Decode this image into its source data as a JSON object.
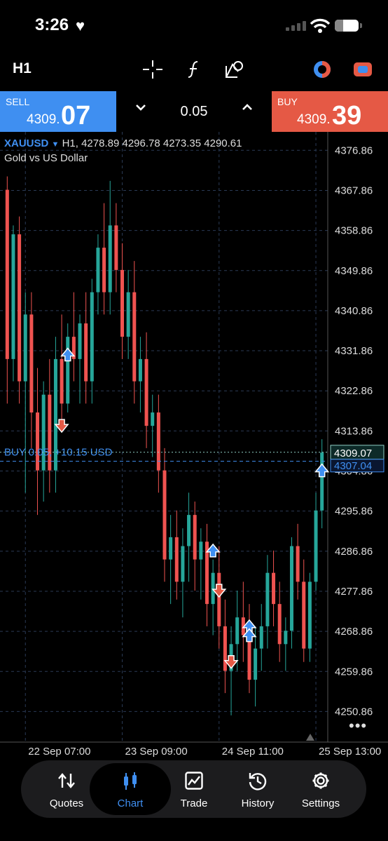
{
  "status": {
    "time": "3:26"
  },
  "toolbar": {
    "timeframe": "H1"
  },
  "trade": {
    "sell_label": "SELL",
    "sell_price_small": "4309.",
    "sell_price_big": "07",
    "lot": "0.05",
    "buy_label": "BUY",
    "buy_price_small": "4309.",
    "buy_price_big": "39"
  },
  "chart": {
    "symbol": "XAUUSD",
    "ohlc": "H1, 4278.89 4296.78 4273.35 4290.61",
    "description": "Gold vs US Dollar",
    "position_label": "BUY 0.05, +10.15 USD",
    "bid_label": "4309.07",
    "entry_label": "4307.04",
    "price_axis": [
      "4376.86",
      "4367.86",
      "4358.86",
      "4349.86",
      "4340.86",
      "4331.86",
      "4322.86",
      "4313.86",
      "4304.86",
      "4295.86",
      "4286.86",
      "4277.86",
      "4268.86",
      "4259.86",
      "4250.86"
    ],
    "time_axis": [
      "22 Sep 07:00",
      "23 Sep 09:00",
      "24 Sep 11:00",
      "25 Sep 13:00"
    ],
    "colors": {
      "up": "#26a69a",
      "down": "#ef5350",
      "grid": "#2a3a55",
      "bid": "#8fcfc4",
      "accent": "#3f8ff1"
    }
  },
  "chart_data": {
    "type": "candlestick",
    "x": [
      "22 Sep 07:00",
      "23 Sep 09:00",
      "24 Sep 11:00",
      "25 Sep 13:00"
    ],
    "ylim": [
      4244,
      4381
    ],
    "last_price": 4309.07,
    "position_open_price": 4307.04,
    "series": [
      {
        "values": [
          [
            4368,
            4371,
            4320,
            4330
          ],
          [
            4330,
            4360,
            4325,
            4358
          ],
          [
            4358,
            4362,
            4320,
            4325
          ],
          [
            4325,
            4345,
            4300,
            4340
          ],
          [
            4340,
            4345,
            4310,
            4318
          ],
          [
            4318,
            4328,
            4295,
            4305
          ],
          [
            4305,
            4325,
            4298,
            4322
          ],
          [
            4322,
            4330,
            4300,
            4305
          ],
          [
            4305,
            4335,
            4300,
            4330
          ],
          [
            4330,
            4340,
            4315,
            4320
          ],
          [
            4320,
            4338,
            4318,
            4335
          ],
          [
            4335,
            4345,
            4325,
            4330
          ],
          [
            4330,
            4340,
            4320,
            4338
          ],
          [
            4338,
            4345,
            4320,
            4325
          ],
          [
            4325,
            4348,
            4320,
            4345
          ],
          [
            4345,
            4358,
            4340,
            4355
          ],
          [
            4355,
            4365,
            4340,
            4345
          ],
          [
            4345,
            4370,
            4340,
            4360
          ],
          [
            4360,
            4365,
            4345,
            4350
          ],
          [
            4350,
            4356,
            4330,
            4335
          ],
          [
            4335,
            4350,
            4330,
            4345
          ],
          [
            4345,
            4352,
            4320,
            4325
          ],
          [
            4325,
            4335,
            4318,
            4330
          ],
          [
            4330,
            4336,
            4310,
            4315
          ],
          [
            4315,
            4322,
            4308,
            4318
          ],
          [
            4318,
            4322,
            4300,
            4305
          ],
          [
            4305,
            4310,
            4280,
            4285
          ],
          [
            4285,
            4295,
            4275,
            4290
          ],
          [
            4290,
            4296,
            4276,
            4280
          ],
          [
            4280,
            4292,
            4272,
            4288
          ],
          [
            4288,
            4300,
            4280,
            4295
          ],
          [
            4295,
            4298,
            4278,
            4285
          ],
          [
            4285,
            4292,
            4276,
            4289
          ],
          [
            4289,
            4293,
            4270,
            4275
          ],
          [
            4275,
            4285,
            4268,
            4282
          ],
          [
            4282,
            4288,
            4265,
            4270
          ],
          [
            4270,
            4276,
            4255,
            4260
          ],
          [
            4260,
            4270,
            4250,
            4266
          ],
          [
            4266,
            4278,
            4260,
            4272
          ],
          [
            4272,
            4280,
            4262,
            4268
          ],
          [
            4268,
            4275,
            4255,
            4258
          ],
          [
            4258,
            4270,
            4252,
            4265
          ],
          [
            4265,
            4275,
            4260,
            4270
          ],
          [
            4270,
            4286,
            4265,
            4282
          ],
          [
            4282,
            4287,
            4270,
            4275
          ],
          [
            4275,
            4280,
            4262,
            4266
          ],
          [
            4266,
            4272,
            4260,
            4269
          ],
          [
            4269,
            4290,
            4265,
            4288
          ],
          [
            4288,
            4293,
            4276,
            4280
          ],
          [
            4280,
            4285,
            4262,
            4265
          ],
          [
            4265,
            4282,
            4262,
            4280
          ],
          [
            4280,
            4300,
            4278,
            4296
          ],
          [
            4296,
            4312,
            4292,
            4309
          ]
        ]
      }
    ],
    "trade_markers": [
      {
        "type": "buy",
        "index": 10,
        "price": 4331
      },
      {
        "type": "sell",
        "index": 9,
        "price": 4315
      },
      {
        "type": "buy",
        "index": 34,
        "price": 4287
      },
      {
        "type": "sell",
        "index": 35,
        "price": 4278
      },
      {
        "type": "sell",
        "index": 37,
        "price": 4262
      },
      {
        "type": "buy",
        "index": 40,
        "price": 4270
      },
      {
        "type": "buy",
        "index": 40,
        "price": 4268
      },
      {
        "type": "buy",
        "index": 52,
        "price": 4305
      }
    ]
  },
  "tabs": [
    {
      "label": "Quotes",
      "icon": "quotes-icon"
    },
    {
      "label": "Chart",
      "icon": "chart-icon"
    },
    {
      "label": "Trade",
      "icon": "trade-icon"
    },
    {
      "label": "History",
      "icon": "history-icon"
    },
    {
      "label": "Settings",
      "icon": "settings-icon"
    }
  ]
}
